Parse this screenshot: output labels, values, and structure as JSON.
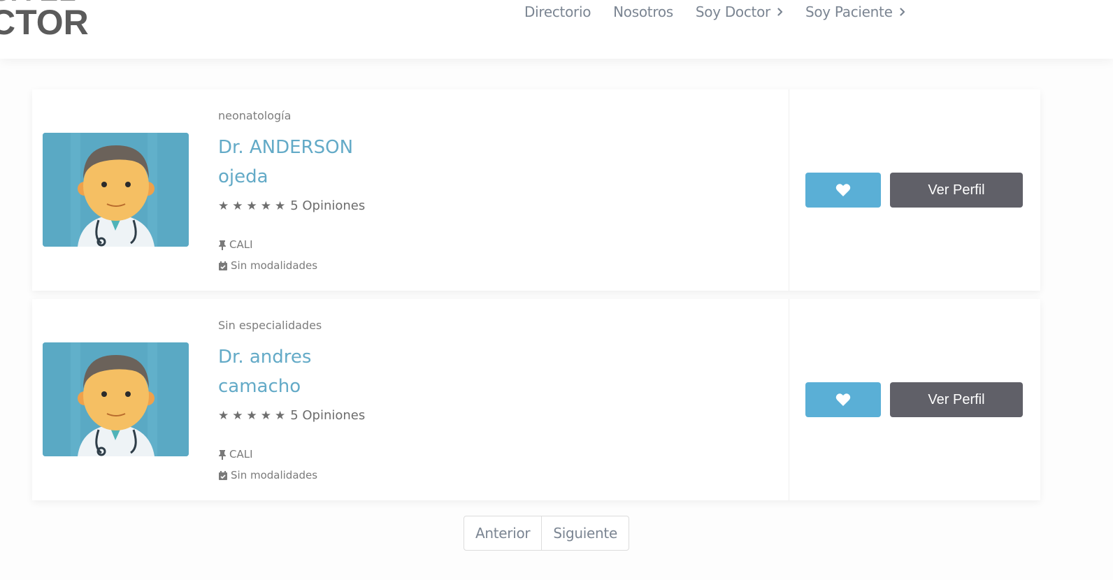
{
  "brand": {
    "logo_line1": "CA EL",
    "logo_line2": "CTOR"
  },
  "nav": {
    "items": [
      {
        "label": "Directorio"
      },
      {
        "label": "Nosotros"
      },
      {
        "label": "Soy Doctor",
        "has_chevron": true
      },
      {
        "label": "Soy Paciente",
        "has_chevron": true
      }
    ]
  },
  "doctors": [
    {
      "specialty": "neonatología",
      "name_line1": "Dr. ANDERSON",
      "name_line2": "ojeda",
      "stars": "★★★★★",
      "reviews": "5 Opiniones",
      "city": "CALI",
      "modalities": "Sin modalidades",
      "profile_button": "Ver Perfil"
    },
    {
      "specialty": "Sin especialidades",
      "name_line1": "Dr. andres",
      "name_line2": "camacho",
      "stars": "★★★★★",
      "reviews": "5 Opiniones",
      "city": "CALI",
      "modalities": "Sin modalidades",
      "profile_button": "Ver Perfil"
    }
  ],
  "pagination": {
    "prev": "Anterior",
    "next": "Siguiente"
  },
  "colors": {
    "accent": "#63aac7",
    "favorite_button": "#5aafd6",
    "profile_button": "#606068",
    "avatar_bg": "#5aa9c4"
  },
  "icons": [
    "chevron-right-icon",
    "heart-icon",
    "pin-icon",
    "calendar-check-icon",
    "doctor-avatar"
  ]
}
